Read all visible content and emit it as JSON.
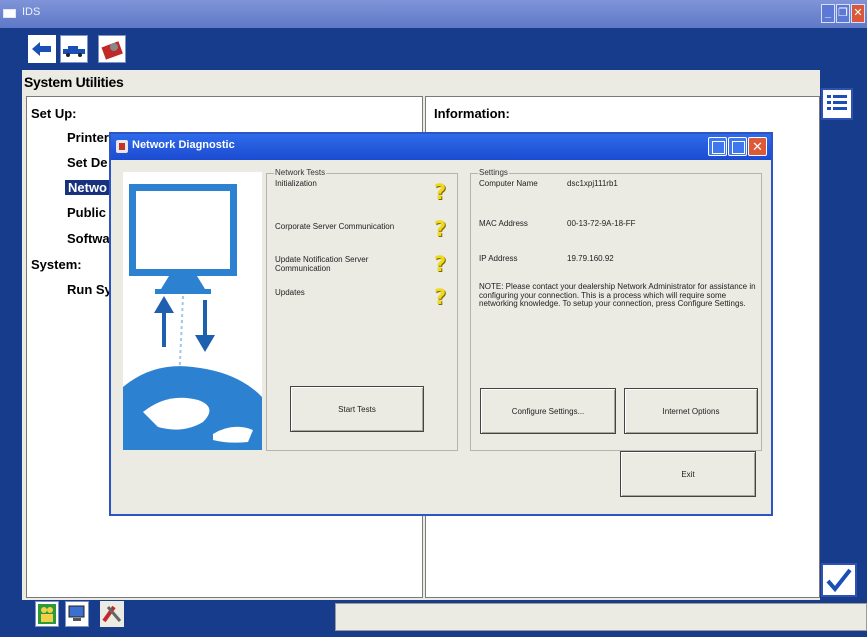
{
  "window": {
    "title": "IDS",
    "controls": {
      "minimize": "minimize-icon",
      "maximize": "maximize-icon",
      "close": "close-icon"
    }
  },
  "toolbar": {
    "icons": [
      "back-arrow-icon",
      "vehicle-icon",
      "toolbox-icon"
    ]
  },
  "page": {
    "title": "System Utilities"
  },
  "setup": {
    "heading": "Set Up:",
    "items": [
      "Printer",
      "Set De",
      "Netwo",
      "Public",
      "Softwa"
    ],
    "selected_index": 2
  },
  "system": {
    "heading": "System:",
    "items": [
      "Run Sy"
    ]
  },
  "information": {
    "heading": "Information:"
  },
  "right_rail": {
    "icons": [
      "list-icon",
      "checkmark-icon"
    ]
  },
  "bottom_bar": {
    "icons": [
      "people-icon",
      "monitor-icon",
      "tools-icon"
    ]
  },
  "dialog": {
    "title": "Network Diagnostic",
    "tests": {
      "group_label": "Network Tests",
      "items": [
        {
          "label": "Initialization",
          "status_icon": "question-mark-icon"
        },
        {
          "label": "Corporate Server Communication",
          "status_icon": "question-mark-icon"
        },
        {
          "label": "Update Notification Server Communication",
          "status_icon": "question-mark-icon"
        },
        {
          "label": "Updates",
          "status_icon": "question-mark-icon"
        }
      ],
      "status_glyph": "?",
      "start_button": "Start Tests"
    },
    "settings": {
      "group_label": "Settings",
      "computer_name_label": "Computer Name",
      "computer_name_value": "dsc1xpj111rb1",
      "mac_label": "MAC Address",
      "mac_value": "00-13-72-9A-18-FF",
      "ip_label": "IP Address",
      "ip_value": "19.79.160.92",
      "note": "NOTE: Please contact your dealership Network Administrator for assistance in configuring your connection. This is a process which will require some networking knowledge. To setup your connection, press Configure Settings.",
      "configure_button": "Configure Settings...",
      "internet_button": "Internet Options"
    },
    "exit_button": "Exit"
  },
  "colors": {
    "navy": "#173c8c",
    "dialog_title_blue": "#1b4bd1",
    "selection": "#17317e",
    "panel_gray": "#ebeae3",
    "question_yellow": "#f0d81a"
  }
}
